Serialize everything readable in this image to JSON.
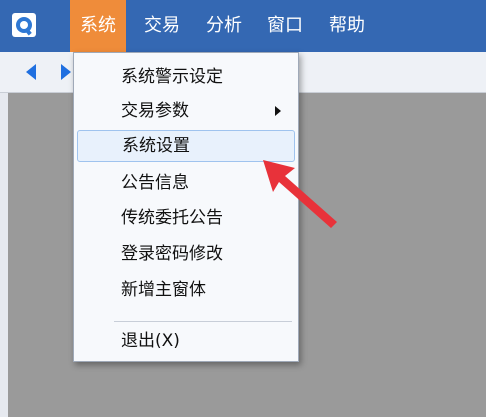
{
  "menubar": {
    "logo_icon": "app-logo-icon",
    "items": [
      {
        "label": "系统",
        "active": true
      },
      {
        "label": "交易",
        "active": false
      },
      {
        "label": "分析",
        "active": false
      },
      {
        "label": "窗口",
        "active": false
      },
      {
        "label": "帮助",
        "active": false
      }
    ]
  },
  "toolbar": {
    "back_icon": "back-arrow-icon",
    "forward_icon": "forward-arrow-icon"
  },
  "dropdown": {
    "items": [
      {
        "label": "系统警示设定",
        "has_submenu": false
      },
      {
        "label": "交易参数",
        "has_submenu": true
      },
      {
        "label": "系统设置",
        "has_submenu": false,
        "highlighted": true
      },
      {
        "label": "公告信息",
        "has_submenu": false
      },
      {
        "label": "传统委托公告",
        "has_submenu": false
      },
      {
        "label": "登录密码修改",
        "has_submenu": false
      },
      {
        "label": "新增主窗体",
        "has_submenu": false
      },
      {
        "label": "退出(X)",
        "has_submenu": false
      }
    ]
  },
  "annotation": {
    "icon": "red-pointer-arrow-icon",
    "color": "#e8323a"
  },
  "colors": {
    "menubar_bg": "#3468b3",
    "active_menu_bg": "#ef8c3a",
    "workspace_bg": "#9a9a9a",
    "highlight_bg": "#e8f1fc"
  }
}
